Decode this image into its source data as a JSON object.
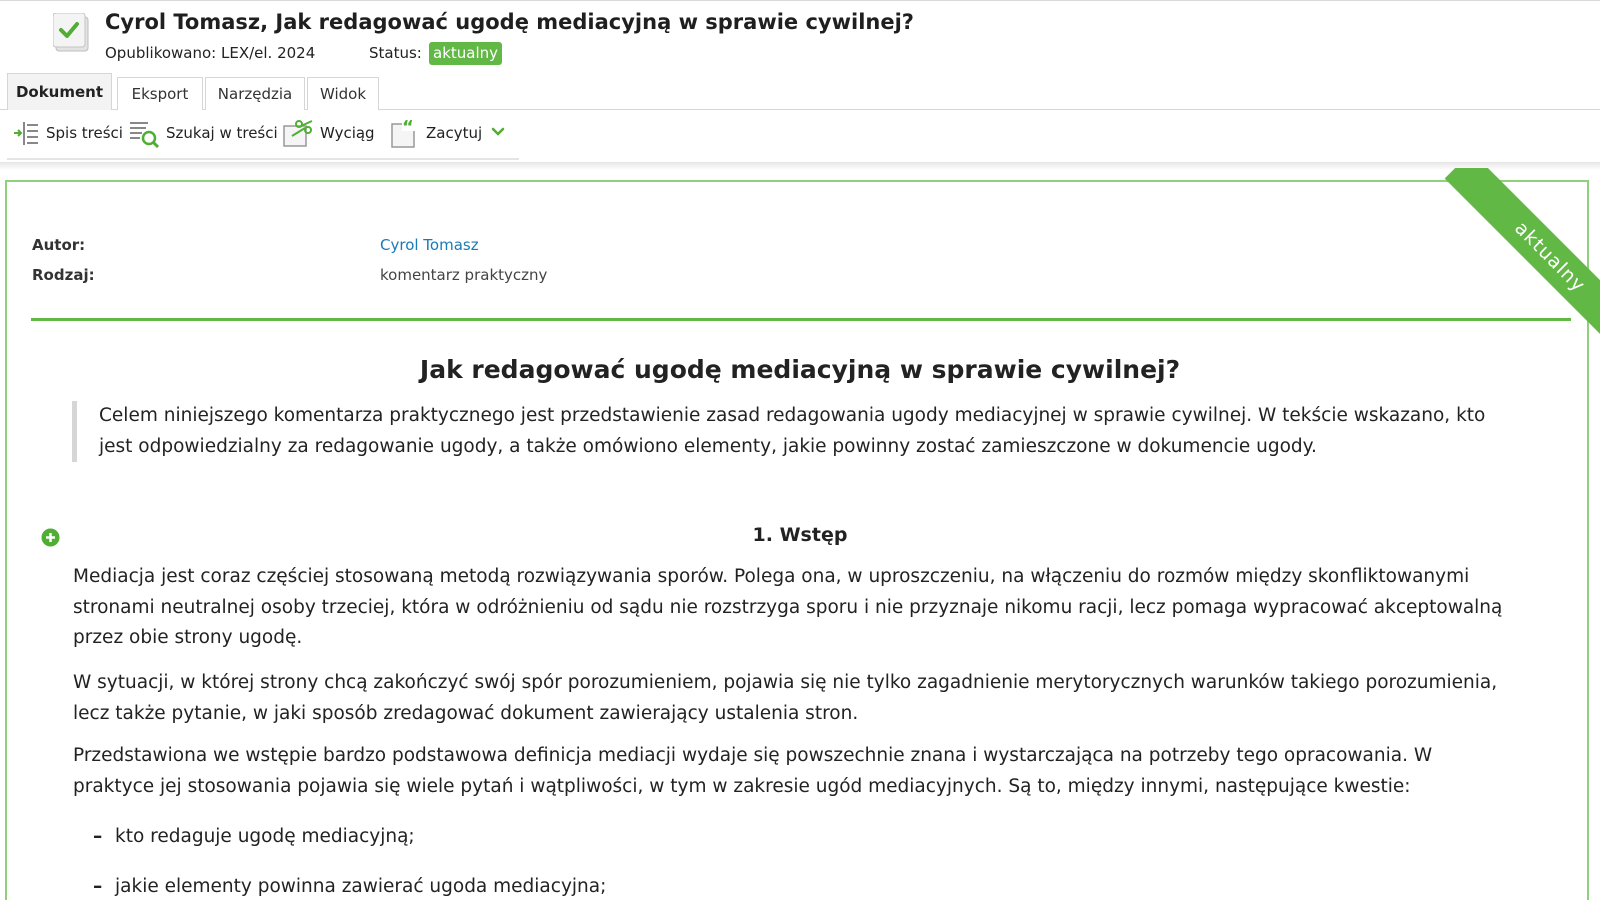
{
  "header": {
    "title": "Cyrol Tomasz, Jak redagować ugodę mediacyjną w sprawie cywilnej?",
    "published": "Opublikowano: LEX/el. 2024",
    "status_label": "Status:",
    "status_value": "aktualny",
    "icon": "checked-document-icon"
  },
  "tabs": [
    {
      "label": "Dokument",
      "active": true
    },
    {
      "label": "Eksport",
      "active": false
    },
    {
      "label": "Narzędzia",
      "active": false
    },
    {
      "label": "Widok",
      "active": false
    }
  ],
  "toolbar": {
    "toc": {
      "label": "Spis treści",
      "icon": "table-of-contents-icon"
    },
    "search": {
      "label": "Szukaj w treści",
      "icon": "search-in-text-icon"
    },
    "extract": {
      "label": "Wyciąg",
      "icon": "extract-icon"
    },
    "cite": {
      "label": "Zacytuj",
      "icon": "quote-icon"
    },
    "more_icon": "chevron-down-icon"
  },
  "ribbon": "aktualny",
  "meta": {
    "author_label": "Autor:",
    "author_value": "Cyrol Tomasz",
    "type_label": "Rodzaj:",
    "type_value": "komentarz praktyczny"
  },
  "document": {
    "title": "Jak redagować ugodę mediacyjną w sprawie cywilnej?",
    "lead": "Celem niniejszego komentarza praktycznego jest przedstawienie zasad redagowania ugody mediacyjnej w sprawie cywilnej. W tekście wskazano, kto jest odpowiedzialny za redagowanie ugody, a także omówiono elementy, jakie powinny zostać zamieszczone w dokumencie ugody.",
    "section_title": "1. Wstęp",
    "paragraphs": [
      "Mediacja jest coraz częściej stosowaną metodą rozwiązywania sporów. Polega ona, w uproszczeniu, na włączeniu do rozmów między skonfliktowanymi stronami neutralnej osoby trzeciej, która w odróżnieniu od sądu nie rozstrzyga sporu i nie przyznaje nikomu racji, lecz pomaga wypracować akceptowalną przez obie strony ugodę.",
      "W sytuacji, w której strony chcą zakończyć swój spór porozumieniem, pojawia się nie tylko zagadnienie merytorycznych warunków takiego porozumienia, lecz także pytanie, w jaki sposób zredagować dokument zawierający ustalenia stron.",
      "Przedstawiona we wstępie bardzo podstawowa definicja mediacji wydaje się powszechnie znana i wystarczająca na potrzeby tego opracowania. W praktyce jej stosowania pojawia się wiele pytań i wątpliwości, w tym w zakresie ugód mediacyjnych. Są to, między innymi, następujące kwestie:"
    ],
    "list_marker": "–",
    "list": [
      "kto redaguje ugodę mediacyjną;",
      "jakie elementy powinna zawierać ugoda mediacyjna;"
    ]
  },
  "colors": {
    "accent_green": "#62b845",
    "frame_border": "#8fd07a",
    "link_blue": "#1a7ab8"
  }
}
